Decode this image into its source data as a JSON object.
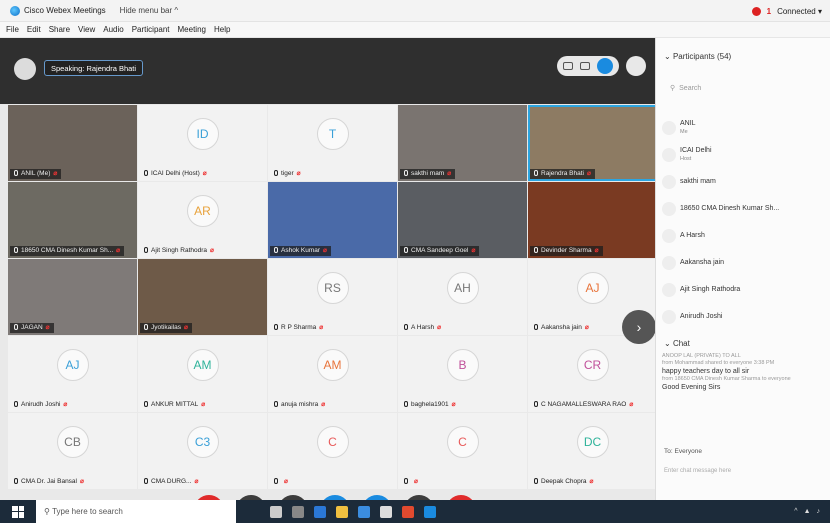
{
  "titlebar": {
    "app_title": "Cisco Webex Meetings",
    "hide_menu_bar": "Hide menu bar ^",
    "connected": "Connected ▾",
    "alert_count": "1"
  },
  "menu": [
    "File",
    "Edit",
    "Share",
    "View",
    "Audio",
    "Participant",
    "Meeting",
    "Help"
  ],
  "speaking_label": "Speaking: Rajendra Bhati",
  "tiles": [
    {
      "name": "ANIL (Me)",
      "type": "video",
      "bg": "#6b625a"
    },
    {
      "name": "ICAI Delhi (Host)",
      "type": "initials",
      "initials": "ID",
      "color": "#3aa0d8"
    },
    {
      "name": "tiger",
      "type": "initials",
      "initials": "T",
      "color": "#3aa0d8"
    },
    {
      "name": "sakthi mam",
      "type": "video",
      "bg": "#7a7470"
    },
    {
      "name": "Rajendra Bhati",
      "type": "video",
      "bg": "#8d7b63",
      "active": true
    },
    {
      "name": "18650 CMA Dinesh Kumar Sh...",
      "type": "video",
      "bg": "#6d6a62"
    },
    {
      "name": "Ajit Singh Rathodra",
      "type": "initials",
      "initials": "AR",
      "color": "#e8a23b"
    },
    {
      "name": "Ashok Kumar",
      "type": "video",
      "bg": "#4a6aa8"
    },
    {
      "name": "CMA Sandeep Goel",
      "type": "video",
      "bg": "#5a5d62"
    },
    {
      "name": "Devinder Sharma",
      "type": "video",
      "bg": "#7a3a22"
    },
    {
      "name": "JAGAN",
      "type": "video",
      "bg": "#7f7a78"
    },
    {
      "name": "Jyotikailas",
      "type": "video",
      "bg": "#6e5a48"
    },
    {
      "name": "R P Sharma",
      "type": "initials",
      "initials": "RS",
      "color": "#777777"
    },
    {
      "name": "A Harsh",
      "type": "initials",
      "initials": "AH",
      "color": "#777777"
    },
    {
      "name": "Aakansha jain",
      "type": "initials",
      "initials": "AJ",
      "color": "#e8743b"
    },
    {
      "name": "Anirudh Joshi",
      "type": "initials",
      "initials": "AJ",
      "color": "#3aa0d8"
    },
    {
      "name": "ANKUR MITTAL",
      "type": "initials",
      "initials": "AM",
      "color": "#2fb39a"
    },
    {
      "name": "anuja mishra",
      "type": "initials",
      "initials": "AM",
      "color": "#e8743b"
    },
    {
      "name": "baghela1901",
      "type": "initials",
      "initials": "B",
      "color": "#c0509a"
    },
    {
      "name": "C NAGAMALLESWARA RAO",
      "type": "initials",
      "initials": "CR",
      "color": "#c0509a"
    },
    {
      "name": "CMA Dr. Jai Bansal",
      "type": "initials",
      "initials": "CB",
      "color": "#777777"
    },
    {
      "name": "CMA DURG...",
      "type": "initials",
      "initials": "C3",
      "color": "#3aa0d8"
    },
    {
      "name": "",
      "type": "initials",
      "initials": "C",
      "color": "#e85a5a"
    },
    {
      "name": "",
      "type": "initials",
      "initials": "C",
      "color": "#e85a5a"
    },
    {
      "name": "Deepak Chopra",
      "type": "initials",
      "initials": "DC",
      "color": "#2fb39a"
    }
  ],
  "controls": [
    {
      "name": "mute-button",
      "color": "red",
      "glyph": "🎤"
    },
    {
      "name": "video-button",
      "color": "dark",
      "glyph": "▶"
    },
    {
      "name": "share-button",
      "color": "dark",
      "glyph": "⇧"
    },
    {
      "name": "participants-button",
      "color": "blue",
      "glyph": "☺"
    },
    {
      "name": "chat-button",
      "color": "blue",
      "glyph": "◯"
    },
    {
      "name": "more-button",
      "color": "dark",
      "glyph": "···"
    },
    {
      "name": "leave-button",
      "color": "red",
      "glyph": "✕"
    }
  ],
  "panel": {
    "participants_title": "Participants (54)",
    "search_placeholder": "Search",
    "participants": [
      {
        "name": "ANIL",
        "role": "Me"
      },
      {
        "name": "ICAI Delhi",
        "role": "Host"
      },
      {
        "name": "sakthi mam",
        "role": ""
      },
      {
        "name": "18650 CMA Dinesh Kumar Sh...",
        "role": ""
      },
      {
        "name": "A Harsh",
        "role": ""
      },
      {
        "name": "Aakansha jain",
        "role": ""
      },
      {
        "name": "Ajit Singh Rathodra",
        "role": ""
      },
      {
        "name": "Anirudh Joshi",
        "role": ""
      }
    ],
    "chat_title": "Chat",
    "chat_messages": [
      {
        "meta": "ANOOP LAL (PRIVATE) TO ALL",
        "text": ""
      },
      {
        "meta": "from Mohammad shared to everyone  3:38 PM",
        "text": "happy teachers day to all sir"
      },
      {
        "meta": "from 18650 CMA Dinesh Kumar Sharma to everyone",
        "text": "Good Evening Sirs"
      }
    ],
    "to_label": "To:",
    "to_value": "Everyone",
    "chat_input_placeholder": "Enter chat message here"
  },
  "taskbar": {
    "search_text": "Type here to search"
  }
}
